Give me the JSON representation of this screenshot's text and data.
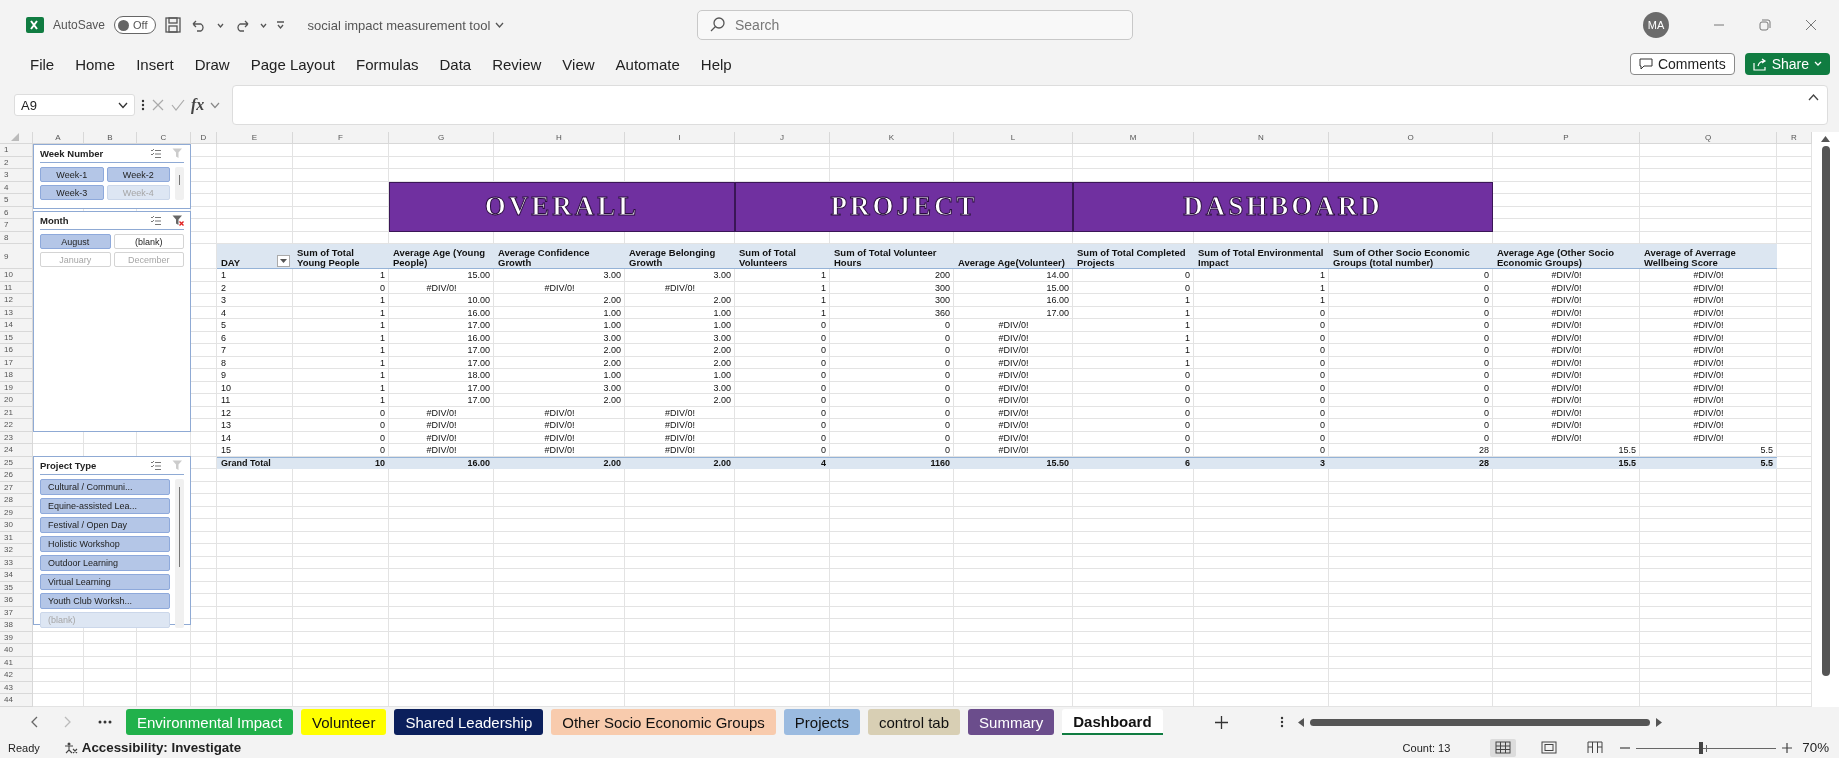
{
  "title_bar": {
    "autosave_label": "AutoSave",
    "autosave": {
      "label": "Off",
      "on": false
    },
    "file_name": "social impact measurement tool",
    "search_placeholder": "Search",
    "avatar_initials": "MA"
  },
  "ribbon_tabs": [
    "File",
    "Home",
    "Insert",
    "Draw",
    "Page Layout",
    "Formulas",
    "Data",
    "Review",
    "View",
    "Automate",
    "Help"
  ],
  "comments_button": "Comments",
  "share_button": "Share",
  "formula_bar": {
    "name_box": "A9",
    "function_label": "fx"
  },
  "sheet": {
    "columns": [
      "A",
      "B",
      "C",
      "D",
      "E",
      "F",
      "G",
      "H",
      "I",
      "J",
      "K",
      "L",
      "M",
      "N",
      "O",
      "P",
      "Q",
      "R"
    ],
    "rows": [
      "1",
      "2",
      "3",
      "4",
      "5",
      "6",
      "7",
      "8",
      "9",
      "10",
      "11",
      "12",
      "13",
      "14",
      "15",
      "16",
      "17",
      "18",
      "19",
      "20",
      "21",
      "22",
      "23",
      "24",
      "25",
      "26",
      "27",
      "28",
      "29",
      "30",
      "31",
      "32",
      "33",
      "34",
      "35",
      "36",
      "37",
      "38",
      "39",
      "40",
      "41",
      "42",
      "43",
      "44"
    ],
    "banner": [
      "OVERALL",
      "PROJECT",
      "DASHBOARD"
    ],
    "pivot": {
      "headers": [
        "DAY",
        "Sum of Total Young People",
        "Average Age (Young People)",
        "Average Confidence Growth",
        "Average Belonging Growth",
        "Sum of Total Volunteers",
        "Sum of Total Volunteer Hours",
        "Average Age(Volunteer)",
        "Sum of Total Completed Projects",
        "Sum of Total Environmental Impact",
        "Sum of Other Socio Economic Groups (total number)",
        "Average Age  (Other Socio Economic Groups)",
        "Average of Averrage Wellbeing Score"
      ],
      "rows": [
        [
          "1",
          "1",
          "15.00",
          "3.00",
          "3.00",
          "1",
          "200",
          "14.00",
          "0",
          "1",
          "0",
          {
            "error": "#DIV/0!"
          },
          {
            "error": "#DIV/0!"
          }
        ],
        [
          "2",
          "0",
          {
            "error": "#DIV/0!"
          },
          {
            "error": "#DIV/0!"
          },
          {
            "error": "#DIV/0!"
          },
          "1",
          "300",
          "15.00",
          "0",
          "1",
          "0",
          {
            "error": "#DIV/0!"
          },
          {
            "error": "#DIV/0!"
          }
        ],
        [
          "3",
          "1",
          "10.00",
          "2.00",
          "2.00",
          "1",
          "300",
          "16.00",
          "1",
          "1",
          "0",
          {
            "error": "#DIV/0!"
          },
          {
            "error": "#DIV/0!"
          }
        ],
        [
          "4",
          "1",
          "16.00",
          "1.00",
          "1.00",
          "1",
          "360",
          "17.00",
          "1",
          "0",
          "0",
          {
            "error": "#DIV/0!"
          },
          {
            "error": "#DIV/0!"
          }
        ],
        [
          "5",
          "1",
          "17.00",
          "1.00",
          "1.00",
          "0",
          "0",
          {
            "error": "#DIV/0!"
          },
          "1",
          "0",
          "0",
          {
            "error": "#DIV/0!"
          },
          {
            "error": "#DIV/0!"
          }
        ],
        [
          "6",
          "1",
          "16.00",
          "3.00",
          "3.00",
          "0",
          "0",
          {
            "error": "#DIV/0!"
          },
          "1",
          "0",
          "0",
          {
            "error": "#DIV/0!"
          },
          {
            "error": "#DIV/0!"
          }
        ],
        [
          "7",
          "1",
          "17.00",
          "2.00",
          "2.00",
          "0",
          "0",
          {
            "error": "#DIV/0!"
          },
          "1",
          "0",
          "0",
          {
            "error": "#DIV/0!"
          },
          {
            "error": "#DIV/0!"
          }
        ],
        [
          "8",
          "1",
          "17.00",
          "2.00",
          "2.00",
          "0",
          "0",
          {
            "error": "#DIV/0!"
          },
          "1",
          "0",
          "0",
          {
            "error": "#DIV/0!"
          },
          {
            "error": "#DIV/0!"
          }
        ],
        [
          "9",
          "1",
          "18.00",
          "1.00",
          "1.00",
          "0",
          "0",
          {
            "error": "#DIV/0!"
          },
          "0",
          "0",
          "0",
          {
            "error": "#DIV/0!"
          },
          {
            "error": "#DIV/0!"
          }
        ],
        [
          "10",
          "1",
          "17.00",
          "3.00",
          "3.00",
          "0",
          "0",
          {
            "error": "#DIV/0!"
          },
          "0",
          "0",
          "0",
          {
            "error": "#DIV/0!"
          },
          {
            "error": "#DIV/0!"
          }
        ],
        [
          "11",
          "1",
          "17.00",
          "2.00",
          "2.00",
          "0",
          "0",
          {
            "error": "#DIV/0!"
          },
          "0",
          "0",
          "0",
          {
            "error": "#DIV/0!"
          },
          {
            "error": "#DIV/0!"
          }
        ],
        [
          "12",
          "0",
          {
            "error": "#DIV/0!"
          },
          {
            "error": "#DIV/0!"
          },
          {
            "error": "#DIV/0!"
          },
          "0",
          "0",
          {
            "error": "#DIV/0!"
          },
          "0",
          "0",
          "0",
          {
            "error": "#DIV/0!"
          },
          {
            "error": "#DIV/0!"
          }
        ],
        [
          "13",
          "0",
          {
            "error": "#DIV/0!"
          },
          {
            "error": "#DIV/0!"
          },
          {
            "error": "#DIV/0!"
          },
          "0",
          "0",
          {
            "error": "#DIV/0!"
          },
          "0",
          "0",
          "0",
          {
            "error": "#DIV/0!"
          },
          {
            "error": "#DIV/0!"
          }
        ],
        [
          "14",
          "0",
          {
            "error": "#DIV/0!"
          },
          {
            "error": "#DIV/0!"
          },
          {
            "error": "#DIV/0!"
          },
          "0",
          "0",
          {
            "error": "#DIV/0!"
          },
          "0",
          "0",
          "0",
          {
            "error": "#DIV/0!"
          },
          {
            "error": "#DIV/0!"
          }
        ],
        [
          "15",
          "0",
          {
            "error": "#DIV/0!"
          },
          {
            "error": "#DIV/0!"
          },
          {
            "error": "#DIV/0!"
          },
          "0",
          "0",
          {
            "error": "#DIV/0!"
          },
          "0",
          "0",
          "28",
          "15.5",
          "5.5"
        ]
      ],
      "grand_total": [
        "Grand Total",
        "10",
        "16.00",
        "2.00",
        "2.00",
        "4",
        "1160",
        "15.50",
        "6",
        "3",
        "28",
        "15.5",
        "5.5"
      ]
    }
  },
  "slicers": [
    {
      "title": "Week Number",
      "kind": "grid",
      "scrollbar": true,
      "filtered": false,
      "items": [
        {
          "label": "Week-1",
          "selected": true,
          "has_data": true
        },
        {
          "label": "Week-2",
          "selected": true,
          "has_data": true
        },
        {
          "label": "Week-3",
          "selected": true,
          "has_data": true
        },
        {
          "label": "Week-4",
          "selected": true,
          "has_data": false
        }
      ]
    },
    {
      "title": "Month",
      "kind": "grid",
      "scrollbar": false,
      "filtered": true,
      "items": [
        {
          "label": "August",
          "selected": true,
          "has_data": true
        },
        {
          "label": "(blank)",
          "selected": false,
          "has_data": true
        },
        {
          "label": "January",
          "selected": false,
          "has_data": false
        },
        {
          "label": "December",
          "selected": false,
          "has_data": false
        }
      ]
    },
    {
      "title": "Project Type",
      "kind": "list",
      "scrollbar": true,
      "filtered": false,
      "items": [
        {
          "label": "Cultural / Communi...",
          "selected": true,
          "has_data": true
        },
        {
          "label": "Equine-assisted Lea...",
          "selected": true,
          "has_data": true
        },
        {
          "label": "Festival / Open Day",
          "selected": true,
          "has_data": true
        },
        {
          "label": "Holistic Workshop",
          "selected": true,
          "has_data": true
        },
        {
          "label": "Outdoor Learning",
          "selected": true,
          "has_data": true
        },
        {
          "label": "Virtual Learning",
          "selected": true,
          "has_data": true
        },
        {
          "label": "Youth Club Worksh...",
          "selected": true,
          "has_data": true
        },
        {
          "label": "(blank)",
          "selected": true,
          "has_data": false
        }
      ]
    }
  ],
  "sheet_tabs": [
    {
      "label": "Environmental Impact",
      "color": "#21b14b",
      "selected": false
    },
    {
      "label": "Volunteer",
      "color": "#ffff00",
      "selected": false
    },
    {
      "label": "Shared Leadership",
      "color": "#0b1f5c",
      "selected": false
    },
    {
      "label": "Other Socio Economic Groups",
      "color": "#f8cbad",
      "selected": false
    },
    {
      "label": "Projects",
      "color": "#9bbbe0",
      "selected": false
    },
    {
      "label": "control tab",
      "color": "#d8cfb4",
      "selected": false
    },
    {
      "label": "Summary",
      "color": "#6b4d8c",
      "selected": false
    },
    {
      "label": "Dashboard",
      "color": "#ffffff",
      "selected": true
    }
  ],
  "status_bar": {
    "ready": "Ready",
    "accessibility": "Accessibility: Investigate",
    "count": "Count: 13",
    "views": [
      {
        "kind": "normal",
        "selected": true
      },
      {
        "kind": "page-layout",
        "selected": false
      },
      {
        "kind": "page-break",
        "selected": false
      }
    ],
    "zoom": {
      "level": 0.46,
      "label": "70%"
    }
  }
}
